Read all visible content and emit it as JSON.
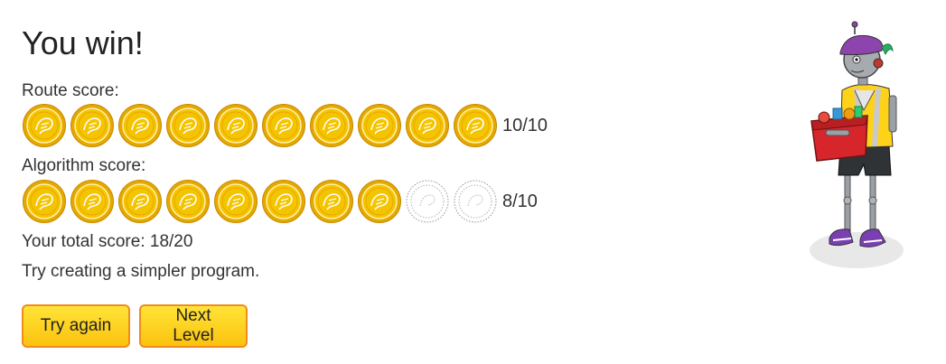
{
  "result": {
    "title": "You win!"
  },
  "route_score": {
    "label": "Route score:",
    "earned": 10,
    "total": 10,
    "text": "10/10"
  },
  "algorithm_score": {
    "label": "Algorithm score:",
    "earned": 8,
    "total": 10,
    "text": "8/10"
  },
  "total_score": {
    "text": "Your total score: 18/20"
  },
  "hint": {
    "text": "Try creating a simpler program."
  },
  "buttons": {
    "try_again": "Try again",
    "next_level": "Next Level"
  },
  "colors": {
    "coin_gold": "#f5c400",
    "coin_rim": "#e6a800",
    "button_fill": "#fbc20e",
    "button_border": "#f08c1c"
  },
  "icons": {
    "earned_coin": "gold-coin-icon",
    "empty_coin": "empty-coin-outline-icon",
    "character": "robot-character-illustration"
  }
}
